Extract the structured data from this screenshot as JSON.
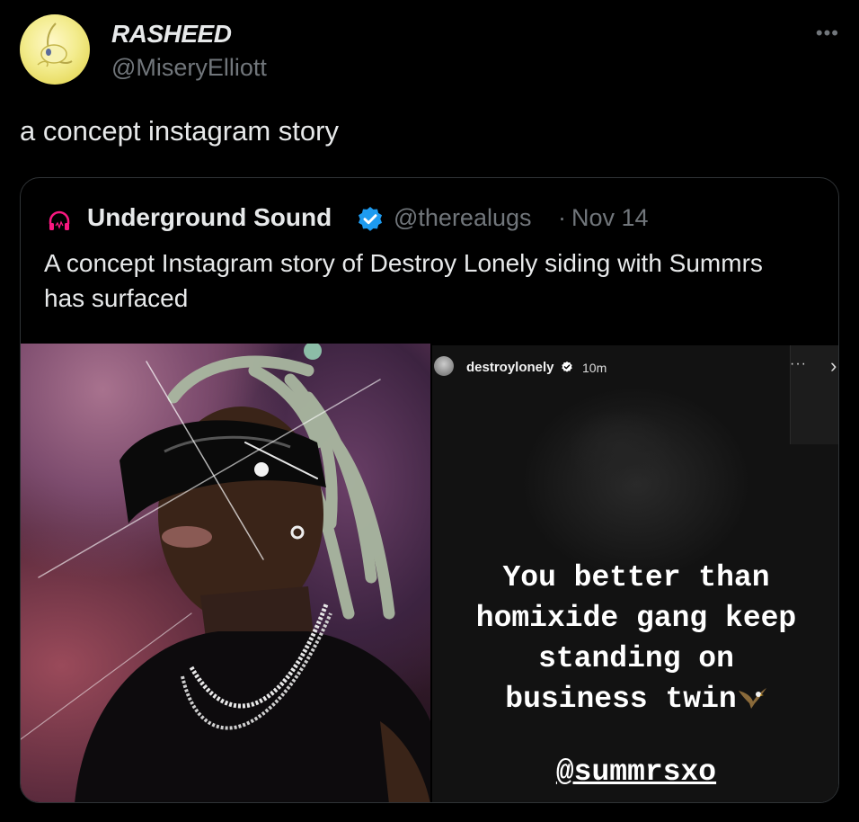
{
  "tweet": {
    "author_name": "RASHEED",
    "author_handle": "@MiseryElliott",
    "more_icon": "ellipsis-icon",
    "text": "a concept instagram story"
  },
  "quote": {
    "icon": "headphones-icon",
    "author_name": "Underground Sound",
    "verified_icon": "verified-badge-icon",
    "author_handle": "@therealugs",
    "separator": "·",
    "date": "Nov 14",
    "text": "A concept Instagram story of Destroy Lonely siding with Summrs has surfaced"
  },
  "story": {
    "username": "destroylonely",
    "time": "10m",
    "more_label": "···",
    "next_label": "›",
    "caption_lines": [
      "You better than",
      "homixide gang keep",
      "standing on",
      "business twin"
    ],
    "mention": "@summrsxo",
    "caption_emoji_icon": "eagle-icon"
  },
  "colors": {
    "background": "#000000",
    "text": "#e7e9ea",
    "secondary": "#71767b",
    "border": "#2f3336",
    "verified": "#1d9bf0",
    "headphones": "#f91880"
  }
}
